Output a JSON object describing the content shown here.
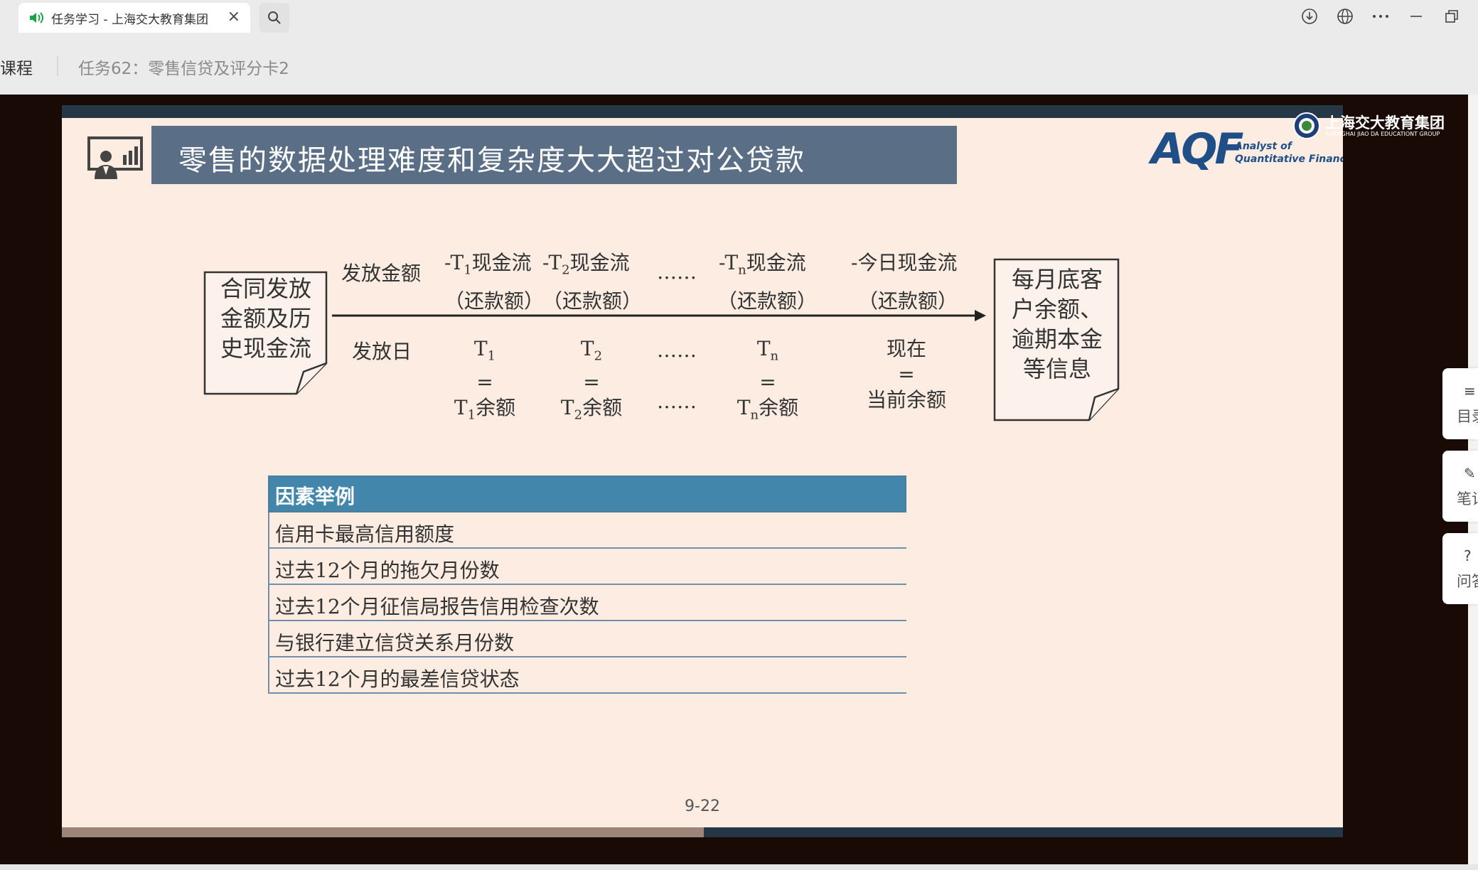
{
  "browser": {
    "tab_title": "任务学习 - 上海交大教育集团",
    "icons": [
      "speaker-icon",
      "close-icon",
      "search-icon",
      "download-icon",
      "globe-icon",
      "more-icon",
      "minimize-icon",
      "restore-icon"
    ]
  },
  "nav": {
    "course_label": "课程",
    "task_label": "任务62：零售信贷及评分卡2"
  },
  "slide": {
    "title": "零售的数据处理难度和复杂度大大超过对公贷款",
    "logo_brand": "AQF",
    "logo_line1": "Analyst of",
    "logo_line2": "Quantitative Finance",
    "corner_logo_cn": "上海交大教育集团",
    "corner_logo_en": "SHANGHAI JIAO DA EDUCATIONT GROUP",
    "left_box": [
      "合同发放",
      "金额及历",
      "史现金流"
    ],
    "right_box": [
      "每月底客",
      "户余额、",
      "逾期本金",
      "等信息"
    ],
    "upper_labels": {
      "issue_amount": "发放金额",
      "t1_cf": "-T",
      "t1_sub": "1",
      "cf_word": "现金流",
      "t2_cf": "-T",
      "t2_sub": "2",
      "dots": "……",
      "tn_cf": "-T",
      "tn_sub": "n",
      "today_cf": "-今日现金流",
      "repay": "（还款额）"
    },
    "lower_labels": {
      "issue_date": "发放日",
      "t": "T",
      "s1": "1",
      "s2": "2",
      "sn": "n",
      "eq": "=",
      "balance": "余额",
      "now": "现在",
      "current_balance": "当前余额",
      "dots": "……"
    },
    "factor_table": {
      "header": "因素举例",
      "rows": [
        "信用卡最高信用额度",
        "过去12个月的拖欠月份数",
        "过去12个月征信局报告信用检查次数",
        "与银行建立信贷关系月份数",
        "过去12个月的最差信贷状态"
      ]
    },
    "page_number": "9-22"
  },
  "side_panel": {
    "toc": "目录",
    "notes": "笔记",
    "qa": "问答"
  },
  "colors": {
    "slide_bg": "#fcece2",
    "title_bg": "#5a6e86",
    "table_header": "#4286ab",
    "video_bg": "#1a0a06"
  }
}
